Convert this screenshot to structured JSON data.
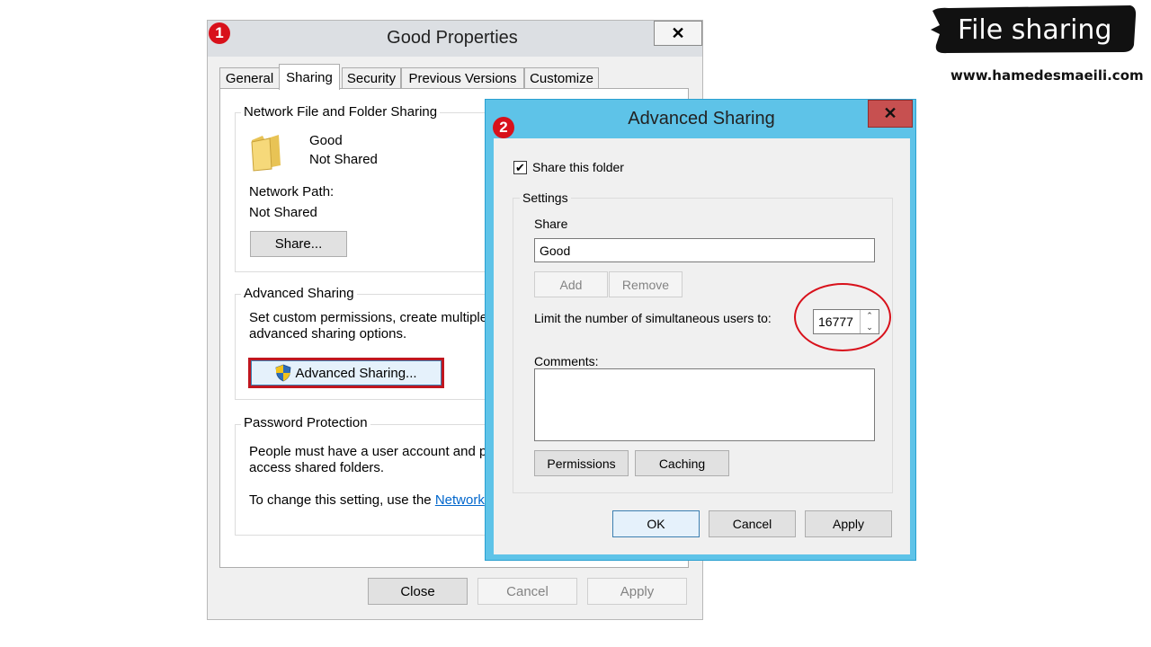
{
  "banner": {
    "title": "File sharing",
    "url": "www.hamedesmaeili.com"
  },
  "badges": {
    "one": "1",
    "two": "2"
  },
  "properties": {
    "title": "Good Properties",
    "close_glyph": "✕",
    "tabs": [
      {
        "label": "General"
      },
      {
        "label": "Sharing"
      },
      {
        "label": "Security"
      },
      {
        "label": "Previous Versions"
      },
      {
        "label": "Customize"
      }
    ],
    "network_group": {
      "title": "Network File and Folder Sharing",
      "folder_name": "Good",
      "folder_status": "Not Shared",
      "path_label": "Network Path:",
      "path_value": "Not Shared",
      "share_button": "Share..."
    },
    "advanced_group": {
      "title": "Advanced Sharing",
      "desc_line1": "Set custom permissions, create multiple",
      "desc_line2": "advanced sharing options.",
      "button": "Advanced Sharing..."
    },
    "password_group": {
      "title": "Password Protection",
      "desc_line1": "People must have a user account and p",
      "desc_line2": "access shared folders.",
      "change_text": "To change this setting, use the ",
      "link_text": "Network"
    },
    "buttons": {
      "close": "Close",
      "cancel": "Cancel",
      "apply": "Apply"
    }
  },
  "advanced_sharing": {
    "title": "Advanced Sharing",
    "close_glyph": "✕",
    "share_checkbox_label": "Share this folder",
    "share_checkbox_checked": true,
    "check_glyph": "✔",
    "settings_title": "Settings",
    "share_label": "Share",
    "share_name": "Good",
    "add_button": "Add",
    "remove_button": "Remove",
    "limit_label": "Limit the number of simultaneous users to:",
    "limit_value": "16777",
    "comments_label": "Comments:",
    "permissions_button": "Permissions",
    "caching_button": "Caching",
    "ok_button": "OK",
    "cancel_button": "Cancel",
    "apply_button": "Apply"
  },
  "colors": {
    "dialog_frame": "#5ec3e8",
    "highlight_red": "#d8111b",
    "close_red": "#c75050"
  }
}
